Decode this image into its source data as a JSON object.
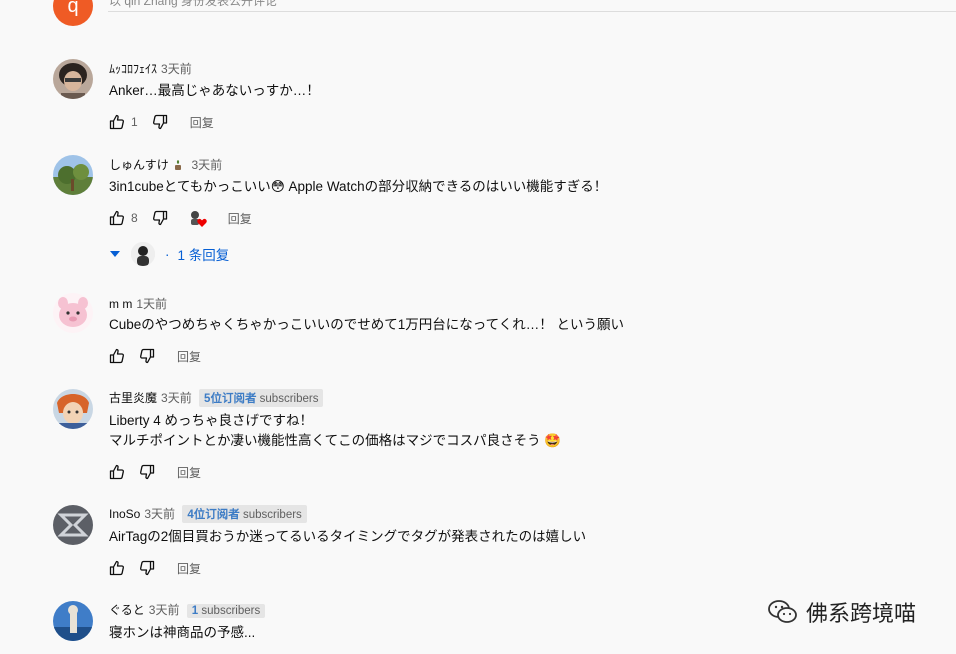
{
  "top": {
    "avatar_letter": "q",
    "hint": "以 qin Zhang 身份发表公开评论"
  },
  "reply_label": "回复",
  "comments": [
    {
      "author": "ﾑｯｺﾛﾌｪｲｽ",
      "time": "3天前",
      "text": "Anker…最高じゃあないっすか…！",
      "likes": "1"
    },
    {
      "author": "しゅんすけ",
      "author_icon": "potted-plant-icon",
      "time": "3天前",
      "text": "3in1cubeとてもかっこいい😳 Apple Watchの部分収納できるのはいい機能すぎる！",
      "likes": "8",
      "replies_label": "1 条回复"
    },
    {
      "author": "m m",
      "time": "1天前",
      "text": "Cubeのやつめちゃくちゃかっこいいのでせめて1万円台になってくれ…！ という願い"
    },
    {
      "author": "古里炎魔",
      "time": "3天前",
      "badge_num": "5位订阅者",
      "badge_word": "subscribers",
      "text_lines": [
        "Liberty 4 めっちゃ良さげですね！",
        "マルチポイントとか凄い機能性高くてこの価格はマジでコスパ良さそう 🤩"
      ]
    },
    {
      "author": "InoSo",
      "time": "3天前",
      "badge_num": "4位订阅者",
      "badge_word": "subscribers",
      "text": "AirTagの2個目買おうか迷ってるいるタイミングでタグが発表されたのは嬉しい"
    },
    {
      "author": "ぐると",
      "time": "3天前",
      "badge_num": "1",
      "badge_word": "subscribers",
      "text": "寝ホンは神商品の予感..."
    }
  ],
  "watermark": "佛系跨境喵"
}
